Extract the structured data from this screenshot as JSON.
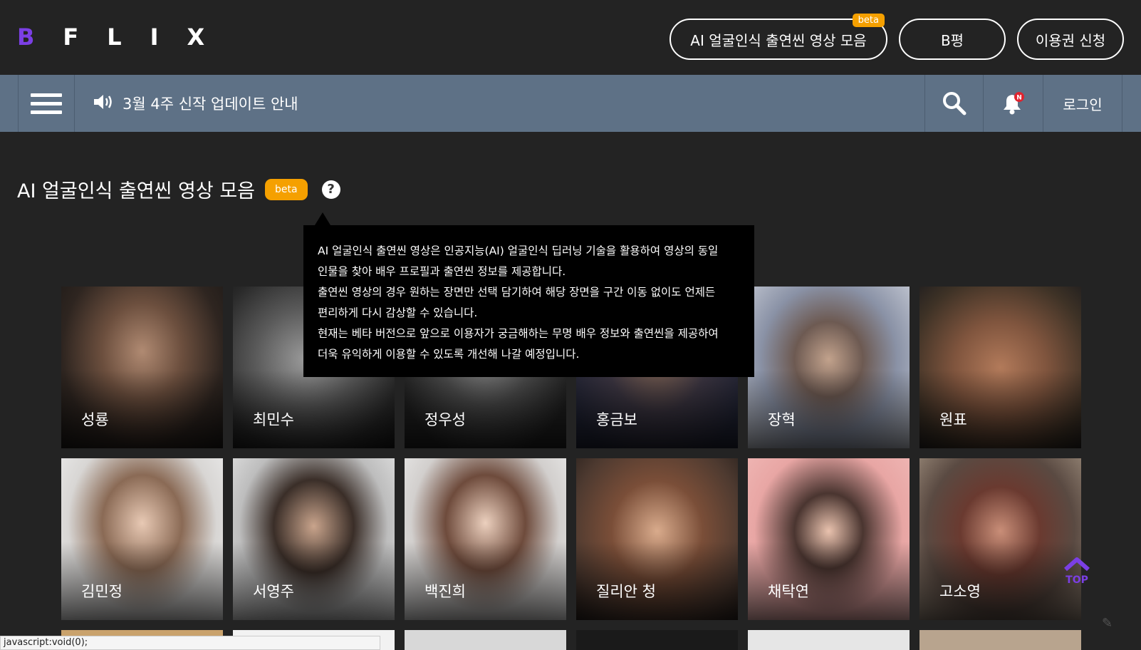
{
  "header": {
    "logo_letters": [
      "B",
      "F",
      "L",
      "I",
      "X"
    ],
    "buttons": {
      "ai_scene": {
        "label": "AI 얼굴인식 출연씬 영상 모음",
        "badge": "beta"
      },
      "review": {
        "label": "B평"
      },
      "subscribe": {
        "label": "이용권 신청"
      }
    }
  },
  "navbar": {
    "notice": "3월 4주 신작 업데이트 안내",
    "notification_badge": "N",
    "login": "로그인"
  },
  "page": {
    "title": "AI 얼굴인식 출연씬 영상 모음",
    "badge": "beta",
    "help": "?"
  },
  "tooltip": {
    "lines": [
      "AI 얼굴인식 출연씬 영상은 인공지능(AI) 얼굴인식 딥러닝 기술을 활용하여 영상의 동일",
      "인물을 찾아 배우 프로필과 출연씬 정보를 제공합니다.",
      "출연씬 영상의 경우 원하는 장면만 선택 담기하여 해당 장면을 구간 이동 없이도 언제든",
      "편리하게 다시 감상할 수 있습니다.",
      "현재는 베타 버전으로 앞으로 이용자가 궁금해하는 무명 배우 정보와 출연씬을 제공하여",
      "더욱 유익하게 이용할 수 있도록 개선해 나갈 예정입니다."
    ]
  },
  "actors": [
    {
      "name": "성룡"
    },
    {
      "name": "최민수"
    },
    {
      "name": "정우성"
    },
    {
      "name": "홍금보"
    },
    {
      "name": "장혁"
    },
    {
      "name": "원표"
    },
    {
      "name": "김민정"
    },
    {
      "name": "서영주"
    },
    {
      "name": "백진희"
    },
    {
      "name": "질리안 청"
    },
    {
      "name": "채탁연"
    },
    {
      "name": "고소영"
    }
  ],
  "top_button": "TOP",
  "status_bar": "javascript:void(0);",
  "colors": {
    "background": "#232323",
    "navbar": "#5e7186",
    "brand_purple": "#7b3fe4",
    "beta_orange": "#f5a000"
  }
}
